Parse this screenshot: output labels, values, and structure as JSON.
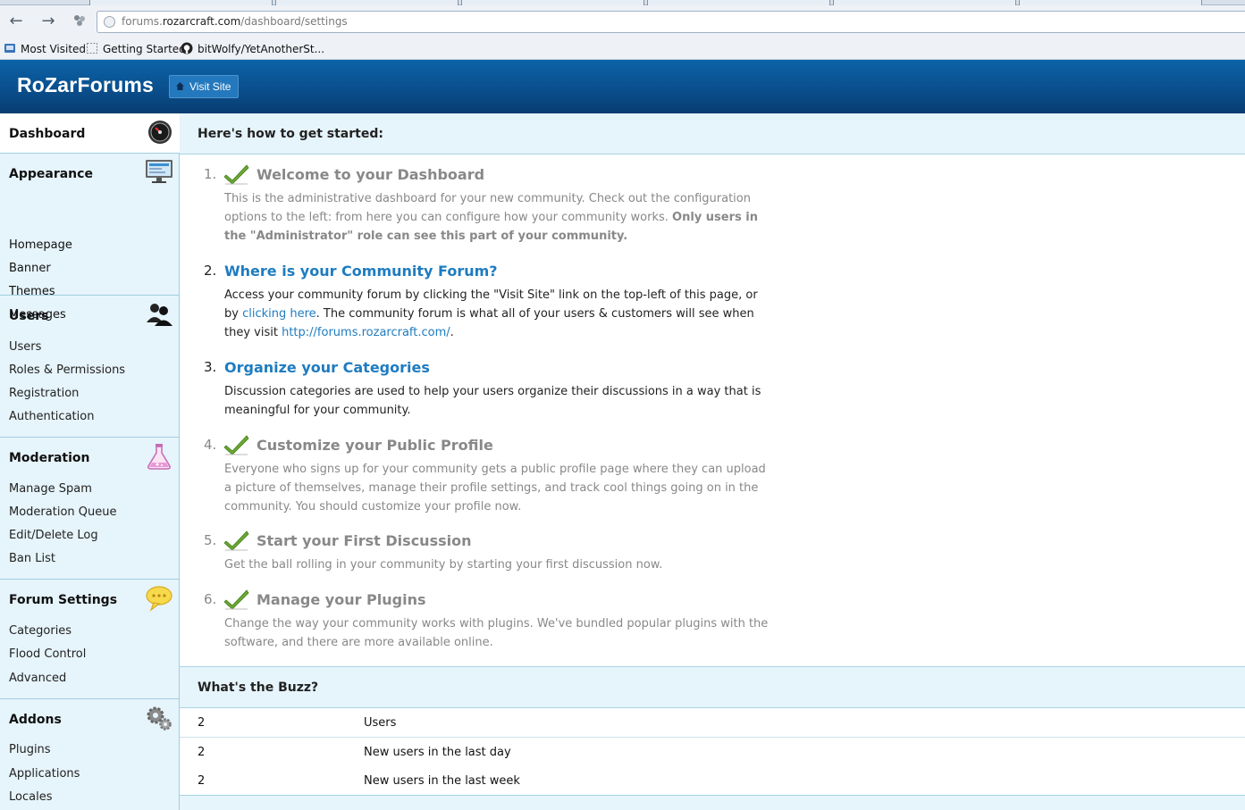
{
  "browser": {
    "url_prefix": "forums.",
    "url_host": "rozarcraft.com",
    "url_path": "/dashboard/settings",
    "bookmarks": [
      "Most Visited",
      "Getting Started",
      "bitWolfy/YetAnotherSt..."
    ]
  },
  "header": {
    "brand": "RoZarForums",
    "visit_site": "Visit Site"
  },
  "sidebar": {
    "dashboard": "Dashboard",
    "groups": [
      {
        "title": "Appearance",
        "items": [
          "Homepage",
          "Banner",
          "Themes",
          "Messages"
        ]
      },
      {
        "title": "Users",
        "items": [
          "Users",
          "Roles & Permissions",
          "Registration",
          "Authentication"
        ]
      },
      {
        "title": "Moderation",
        "items": [
          "Manage Spam",
          "Moderation Queue",
          "Edit/Delete Log",
          "Ban List"
        ]
      },
      {
        "title": "Forum Settings",
        "items": [
          "Categories",
          "Flood Control",
          "Advanced"
        ]
      },
      {
        "title": "Addons",
        "items": [
          "Plugins",
          "Applications",
          "Locales"
        ]
      }
    ]
  },
  "main": {
    "get_started_title": "Here's how to get started:",
    "steps": [
      {
        "num": "1.",
        "title": "Welcome to your Dashboard",
        "text1": "This is the administrative dashboard for your new community. Check out the configuration options to the left: from here you can configure how your community works. ",
        "bold": "Only users in the \"Administrator\" role can see this part of your community."
      },
      {
        "num": "2.",
        "title": "Where is your Community Forum?",
        "text1": "Access your community forum by clicking the \"Visit Site\" link on the top-left of this page, or by ",
        "link1": "clicking here",
        "text2": ". The community forum is what all of your users & customers will see when they visit ",
        "link2": "http://forums.rozarcraft.com/",
        "text3": "."
      },
      {
        "num": "3.",
        "title": "Organize your Categories",
        "text1": "Discussion categories are used to help your users organize their discussions in a way that is meaningful for your community."
      },
      {
        "num": "4.",
        "title": "Customize your Public Profile",
        "text1": "Everyone who signs up for your community gets a public profile page where they can upload a picture of themselves, manage their profile settings, and track cool things going on in the community. You should customize your profile now."
      },
      {
        "num": "5.",
        "title": "Start your First Discussion",
        "text1": "Get the ball rolling in your community by starting your first discussion now."
      },
      {
        "num": "6.",
        "title": "Manage your Plugins",
        "text1": "Change the way your community works with plugins. We've bundled popular plugins with the software, and there are more available online."
      }
    ],
    "buzz_title": "What's the Buzz?",
    "buzz": [
      {
        "count": "2",
        "label": "Users"
      },
      {
        "count": "2",
        "label": "New users in the last day"
      },
      {
        "count": "2",
        "label": "New users in the last week"
      }
    ]
  }
}
